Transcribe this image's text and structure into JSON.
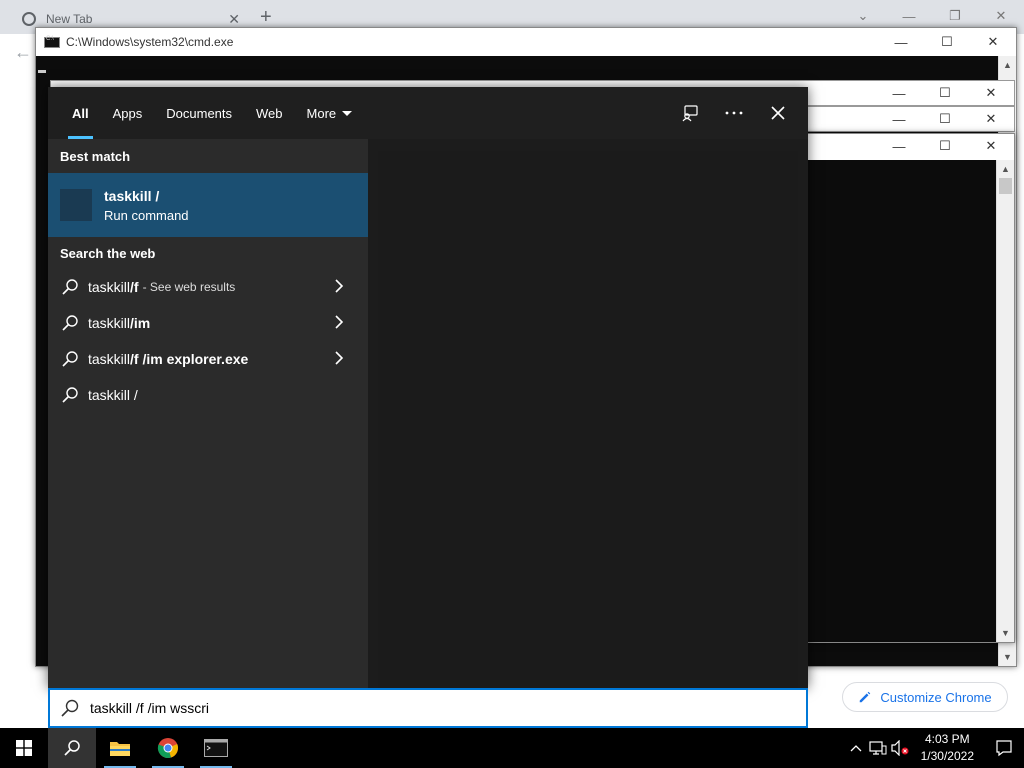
{
  "chrome": {
    "tab_title": "New Tab",
    "customize_label": "Customize Chrome"
  },
  "cmd": {
    "title": "C:\\Windows\\system32\\cmd.exe"
  },
  "search": {
    "tabs": [
      {
        "label": "All"
      },
      {
        "label": "Apps"
      },
      {
        "label": "Documents"
      },
      {
        "label": "Web"
      },
      {
        "label": "More"
      }
    ],
    "best_match_heading": "Best match",
    "best_match": {
      "title": "taskkill /",
      "subtitle": "Run command"
    },
    "web_heading": "Search the web",
    "web_results": [
      {
        "prefix": "taskkill ",
        "bold": "/f",
        "suffix": "- See web results"
      },
      {
        "prefix": "taskkill ",
        "bold": "/im",
        "suffix": ""
      },
      {
        "prefix": "taskkill ",
        "bold": "/f /im explorer.exe",
        "suffix": ""
      },
      {
        "prefix": "taskkill /",
        "bold": "",
        "suffix": ""
      }
    ],
    "query": "taskkill /f /im wsscri"
  },
  "taskbar": {
    "time": "4:03 PM",
    "date": "1/30/2022"
  },
  "colors": {
    "accent": "#0078d7",
    "tab_underline": "#4cc2ff",
    "best_match_bg": "#1b4f72"
  }
}
